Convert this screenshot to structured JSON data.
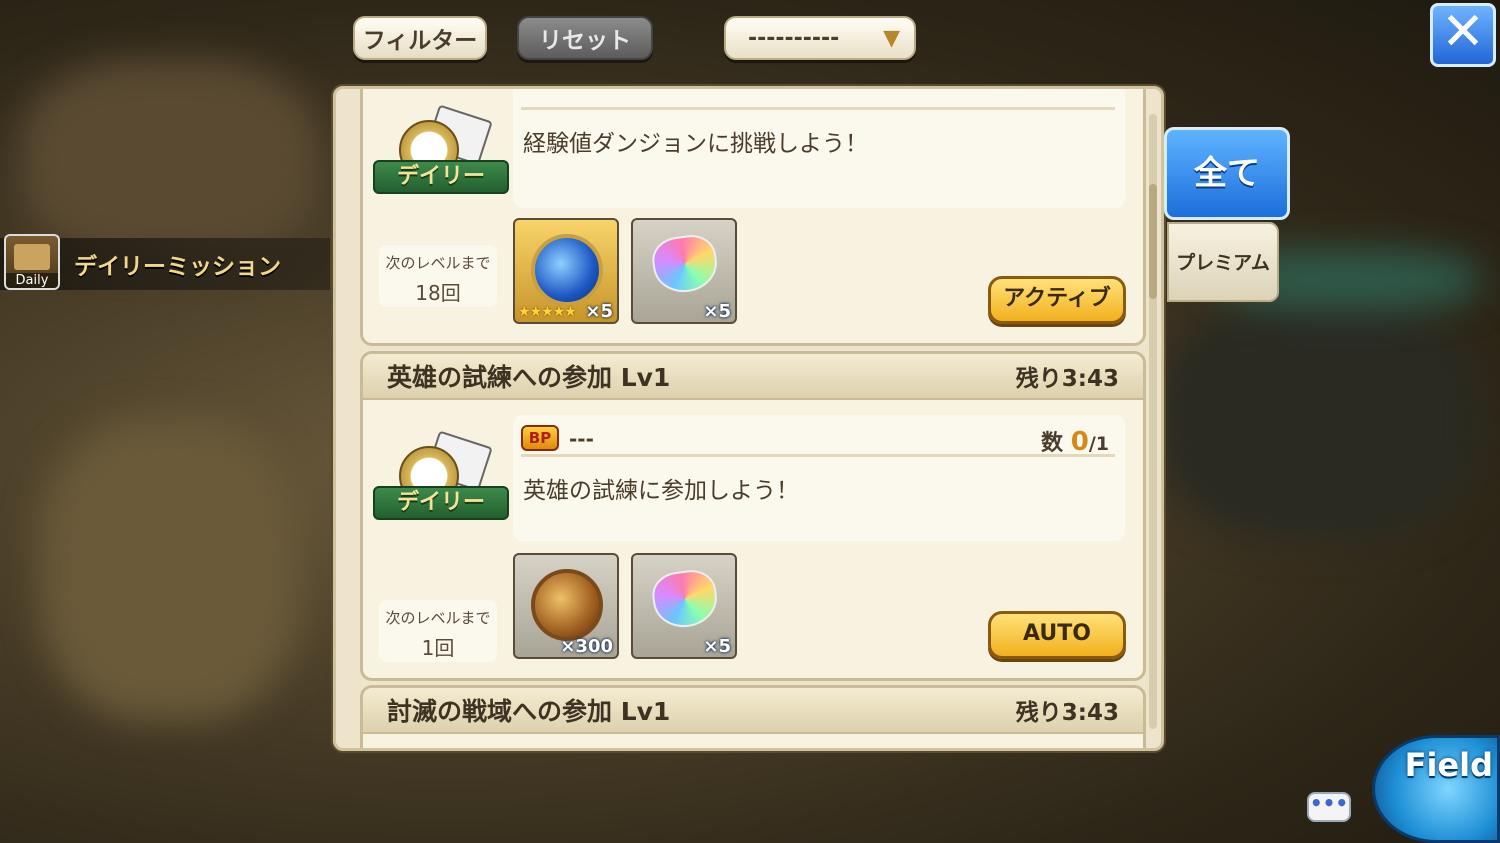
{
  "top_controls": {
    "filter_label": "フィルター",
    "reset_label": "リセット",
    "dropdown_value": "----------"
  },
  "side_label": {
    "icon_text": "Daily",
    "title": "デイリーミッション"
  },
  "tabs": {
    "all": "全て",
    "premium": "プレミアム"
  },
  "missions": [
    {
      "badge": "デイリー",
      "bp": "---",
      "description": "経験値ダンジョンに挑戦しよう！",
      "next_level_label": "次のレベルまで",
      "next_level_value": "18回",
      "rewards": [
        {
          "icon": "blue-orb-icon",
          "quantity": "×5",
          "stars": "★★★★★"
        },
        {
          "icon": "rainbow-gem-icon",
          "quantity": "×5"
        }
      ],
      "action": "アクティブ"
    },
    {
      "title": "英雄の試練への参加 Lv1",
      "remaining": "残り3:43",
      "badge": "デイリー",
      "bp": "---",
      "count_label": "数",
      "count_value": "0",
      "count_total": "/1",
      "description": "英雄の試練に参加しよう！",
      "next_level_label": "次のレベルまで",
      "next_level_value": "1回",
      "rewards": [
        {
          "icon": "hero-medal-icon",
          "quantity": "×300"
        },
        {
          "icon": "rainbow-gem-icon",
          "quantity": "×5"
        }
      ],
      "action": "AUTO"
    },
    {
      "title": "討滅の戦域への参加 Lv1",
      "remaining": "残り3:43"
    }
  ],
  "bottom": {
    "chat": "•••",
    "field": "Field"
  }
}
